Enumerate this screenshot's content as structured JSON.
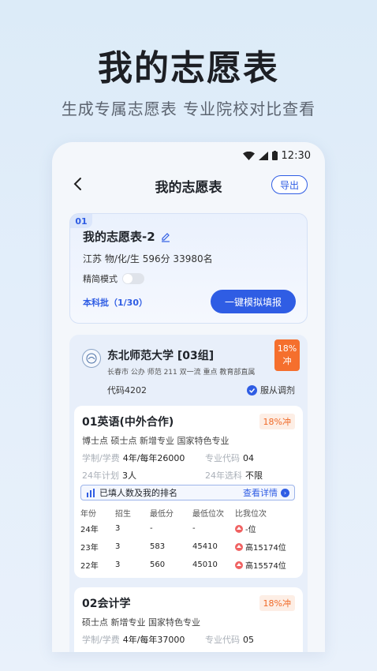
{
  "hero": {
    "title": "我的志愿表",
    "subtitle": "生成专属志愿表 专业院校对比查看"
  },
  "status_bar": {
    "time": "12:30"
  },
  "nav": {
    "title": "我的志愿表",
    "export_label": "导出"
  },
  "plan": {
    "index": "01",
    "name": "我的志愿表-2",
    "info": "江苏 物/化/生 596分 33980名",
    "simple_mode_label": "精简模式",
    "simple_mode_on": false,
    "batch": "本科批（1/30）",
    "fill_button": "一键模拟填报"
  },
  "school": {
    "name": "东北师范大学 [03组]",
    "tags": "长春市 公办 师范 211 双一流 重点 教育部直属",
    "code": "代码4202",
    "adjust_label": "服从调剂",
    "rate_percent": "18%",
    "rate_label": "冲"
  },
  "majors": [
    {
      "title": "01英语(中外合作)",
      "rate": "18%冲",
      "tags": "博士点 硕士点 新增专业 国家特色专业",
      "duration_label": "学制/学费",
      "duration_value": "4年/每年26000",
      "code_label": "专业代码",
      "code_value": "04",
      "plan_label": "24年计划",
      "plan_value": "3人",
      "subject_label": "24年选科",
      "subject_value": "不限",
      "rank_label": "已填人数及我的排名",
      "rank_detail": "查看详情",
      "table": {
        "headers": [
          "年份",
          "招生",
          "最低分",
          "最低位次",
          "比我位次"
        ],
        "rows": [
          [
            "24年",
            "3",
            "-",
            "-",
            "-位"
          ],
          [
            "23年",
            "3",
            "583",
            "45410",
            "高15174位"
          ],
          [
            "22年",
            "3",
            "560",
            "45010",
            "高15574位"
          ]
        ]
      }
    },
    {
      "title": "02会计学",
      "rate": "18%冲",
      "tags": "硕士点 新增专业 国家特色专业",
      "duration_label": "学制/学费",
      "duration_value": "4年/每年37000",
      "code_label": "专业代码",
      "code_value": "05"
    }
  ],
  "colors": {
    "primary": "#2f5de4",
    "warning": "#f56f2d"
  },
  "icons": {
    "back": "chevron-left-icon",
    "edit": "pencil-icon",
    "check": "check-circle-icon",
    "arrow": "arrow-right-circle-icon",
    "chart": "bar-chart-icon",
    "up": "arrow-up-circle-icon"
  }
}
